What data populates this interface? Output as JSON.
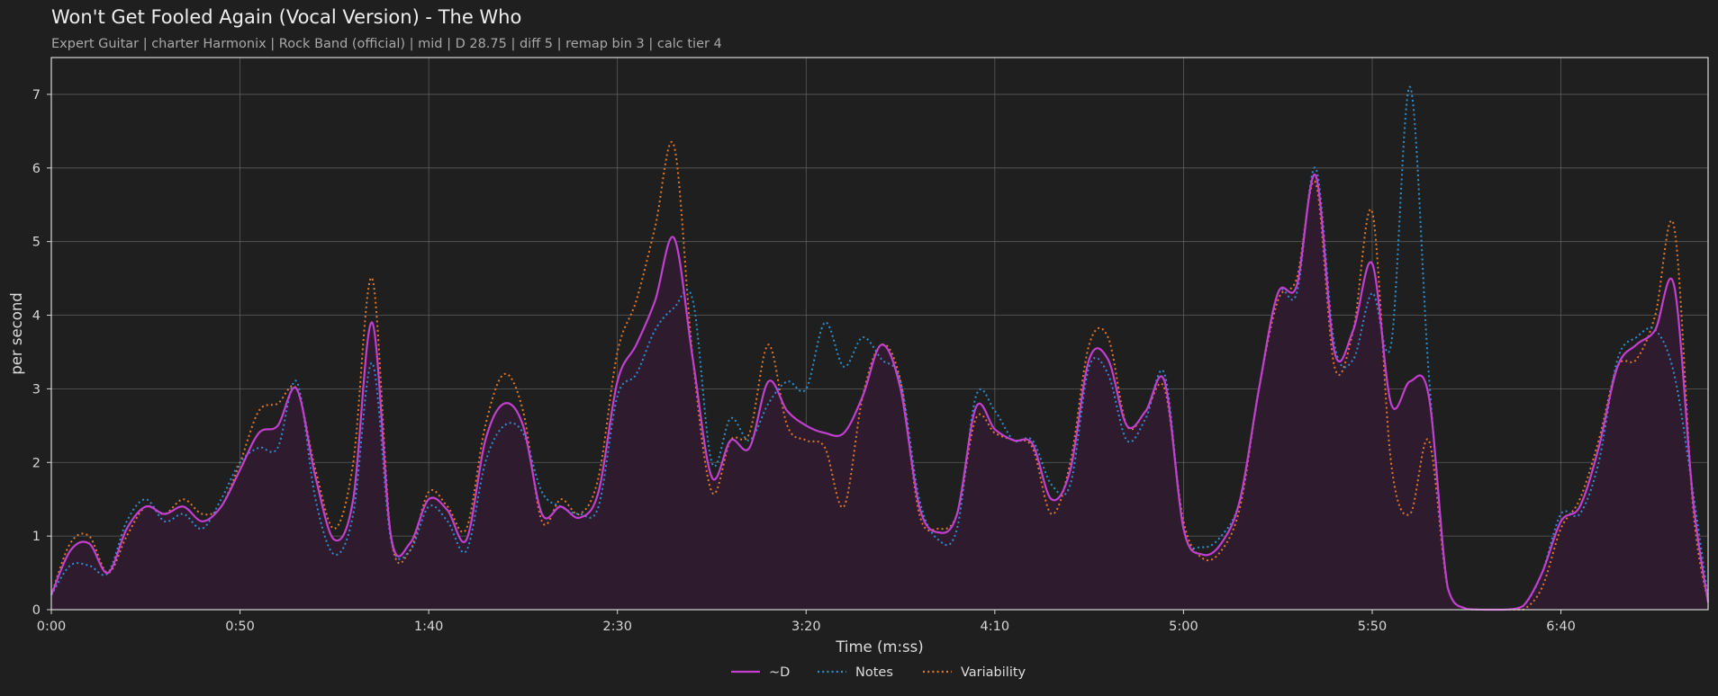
{
  "header": {
    "title": "Won't Get Fooled Again (Vocal Version) - The Who",
    "subtitle": "Expert Guitar  |  charter Harmonix  |  Rock Band (official)  |  mid  |  D 28.75  |  diff 5  |  remap bin 3  |  calc tier 4"
  },
  "colors": {
    "background": "#1f1f1f",
    "D": "#c23fd0",
    "Notes": "#2e8fcf",
    "Variability": "#e0782a",
    "fill": "#2e1b2e",
    "grid": "#6a6a6a"
  },
  "chart_data": {
    "type": "line",
    "title": "Won't Get Fooled Again (Vocal Version) - The Who",
    "xlabel": "Time (m:ss)",
    "ylabel": "per second",
    "xlim": [
      0,
      439
    ],
    "ylim": [
      0,
      7.5
    ],
    "xticks": [
      {
        "value": 0,
        "label": "0:00"
      },
      {
        "value": 50,
        "label": "0:50"
      },
      {
        "value": 100,
        "label": "1:40"
      },
      {
        "value": 150,
        "label": "2:30"
      },
      {
        "value": 200,
        "label": "3:20"
      },
      {
        "value": 250,
        "label": "4:10"
      },
      {
        "value": 300,
        "label": "5:00"
      },
      {
        "value": 350,
        "label": "5:50"
      },
      {
        "value": 400,
        "label": "6:40"
      }
    ],
    "yticks": [
      0,
      1,
      2,
      3,
      4,
      5,
      6,
      7
    ],
    "grid": true,
    "legend_position": "bottom-center",
    "x": [
      0,
      5,
      10,
      15,
      20,
      25,
      30,
      35,
      40,
      45,
      50,
      55,
      60,
      65,
      70,
      75,
      80,
      85,
      90,
      95,
      100,
      105,
      110,
      115,
      120,
      125,
      130,
      135,
      140,
      145,
      150,
      155,
      160,
      165,
      170,
      175,
      180,
      185,
      190,
      195,
      200,
      205,
      210,
      215,
      220,
      225,
      230,
      235,
      240,
      245,
      250,
      255,
      260,
      265,
      270,
      275,
      280,
      285,
      290,
      295,
      300,
      305,
      310,
      315,
      320,
      325,
      330,
      335,
      340,
      345,
      350,
      355,
      360,
      365,
      370,
      375,
      380,
      385,
      390,
      395,
      400,
      405,
      410,
      415,
      420,
      425,
      430,
      435,
      439
    ],
    "series": [
      {
        "name": "~D",
        "style": "solid",
        "color": "#c23fd0",
        "fill": true,
        "values": [
          0.2,
          0.8,
          0.9,
          0.5,
          1.1,
          1.4,
          1.3,
          1.4,
          1.2,
          1.4,
          1.9,
          2.4,
          2.5,
          3.0,
          1.8,
          0.95,
          1.5,
          3.9,
          1.0,
          0.9,
          1.5,
          1.35,
          0.95,
          2.3,
          2.8,
          2.5,
          1.3,
          1.4,
          1.25,
          1.6,
          3.1,
          3.6,
          4.2,
          5.05,
          3.4,
          1.8,
          2.3,
          2.2,
          3.1,
          2.7,
          2.5,
          2.4,
          2.4,
          2.9,
          3.6,
          3.0,
          1.4,
          1.05,
          1.3,
          2.75,
          2.45,
          2.3,
          2.25,
          1.5,
          1.9,
          3.4,
          3.4,
          2.5,
          2.7,
          3.1,
          1.1,
          0.75,
          0.9,
          1.5,
          3.0,
          4.3,
          4.4,
          5.9,
          3.5,
          3.8,
          4.7,
          2.8,
          3.1,
          2.9,
          0.3,
          0.01,
          0.0,
          0.0,
          0.05,
          0.5,
          1.2,
          1.4,
          2.2,
          3.3,
          3.6,
          3.8,
          4.4,
          1.5,
          0.1
        ]
      },
      {
        "name": "Notes",
        "style": "dotted",
        "color": "#2e8fcf",
        "fill": false,
        "values": [
          0.2,
          0.6,
          0.6,
          0.5,
          1.2,
          1.5,
          1.2,
          1.3,
          1.1,
          1.5,
          2.0,
          2.2,
          2.2,
          3.1,
          1.5,
          0.75,
          1.3,
          3.35,
          0.95,
          0.8,
          1.4,
          1.2,
          0.8,
          2.0,
          2.5,
          2.4,
          1.6,
          1.4,
          1.3,
          1.4,
          2.9,
          3.2,
          3.8,
          4.1,
          4.2,
          2.0,
          2.6,
          2.3,
          2.8,
          3.1,
          3.0,
          3.9,
          3.3,
          3.7,
          3.4,
          3.1,
          1.5,
          0.95,
          1.1,
          2.9,
          2.7,
          2.3,
          2.3,
          1.7,
          1.7,
          3.3,
          3.2,
          2.3,
          2.6,
          3.2,
          1.1,
          0.85,
          1.0,
          1.5,
          3.0,
          4.3,
          4.3,
          6.0,
          3.6,
          3.4,
          4.3,
          3.6,
          7.1,
          3.2,
          0.3,
          0.01,
          0.0,
          0.0,
          0.05,
          0.5,
          1.3,
          1.3,
          2.0,
          3.4,
          3.7,
          3.8,
          3.2,
          1.6,
          0.15
        ]
      },
      {
        "name": "Variability",
        "style": "dotted",
        "color": "#e0782a",
        "fill": false,
        "values": [
          0.2,
          0.9,
          1.0,
          0.5,
          1.0,
          1.4,
          1.3,
          1.5,
          1.3,
          1.4,
          2.0,
          2.7,
          2.8,
          3.0,
          1.9,
          1.1,
          2.0,
          4.5,
          1.0,
          0.8,
          1.6,
          1.4,
          1.1,
          2.5,
          3.2,
          2.7,
          1.2,
          1.5,
          1.3,
          1.8,
          3.5,
          4.2,
          5.2,
          6.3,
          3.4,
          1.6,
          2.3,
          2.4,
          3.6,
          2.5,
          2.3,
          2.2,
          1.4,
          2.9,
          3.6,
          3.1,
          1.3,
          1.1,
          1.3,
          2.6,
          2.4,
          2.3,
          2.2,
          1.3,
          2.0,
          3.6,
          3.7,
          2.5,
          2.7,
          3.0,
          1.2,
          0.7,
          0.8,
          1.4,
          3.0,
          4.2,
          4.5,
          5.8,
          3.3,
          3.8,
          5.4,
          2.0,
          1.3,
          2.3,
          0.3,
          0.01,
          0.0,
          0.0,
          0.0,
          0.3,
          1.1,
          1.5,
          2.3,
          3.3,
          3.4,
          4.0,
          5.2,
          1.4,
          0.1
        ]
      }
    ]
  }
}
